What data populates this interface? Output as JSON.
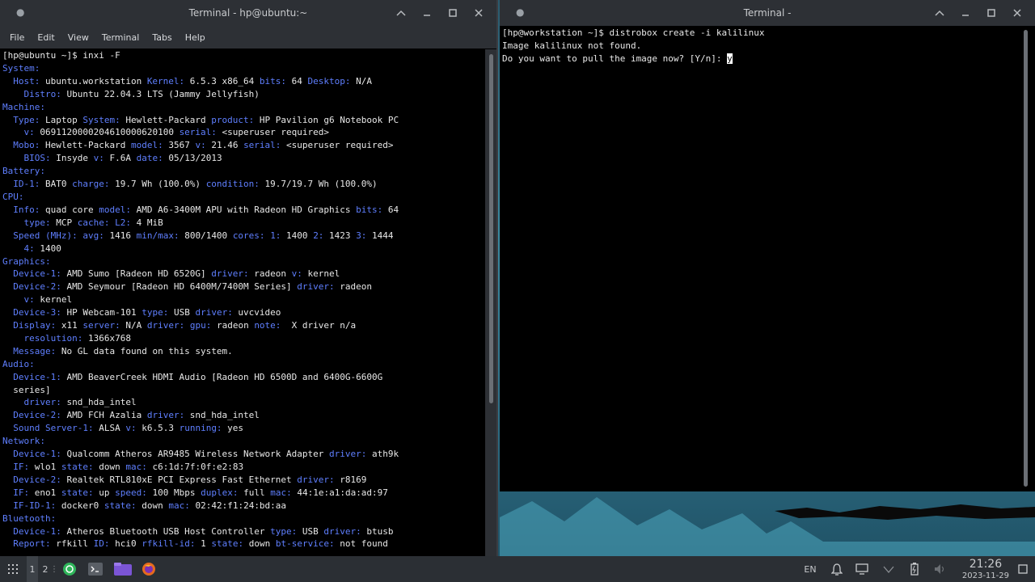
{
  "left_window": {
    "title": "Terminal - hp@ubuntu:~",
    "menu": [
      "File",
      "Edit",
      "View",
      "Terminal",
      "Tabs",
      "Help"
    ],
    "lines": [
      [
        [
          "n",
          "[hp@ubuntu ~]$ inxi -F"
        ]
      ],
      [
        [
          "k",
          "System:"
        ]
      ],
      [
        [
          "k",
          "  Host:"
        ],
        [
          "n",
          " ubuntu.workstation "
        ],
        [
          "k",
          "Kernel:"
        ],
        [
          "n",
          " 6.5.3 x86_64 "
        ],
        [
          "k",
          "bits:"
        ],
        [
          "n",
          " 64 "
        ],
        [
          "k",
          "Desktop:"
        ],
        [
          "n",
          " N/A"
        ]
      ],
      [
        [
          "k",
          "    Distro:"
        ],
        [
          "n",
          " Ubuntu 22.04.3 LTS (Jammy Jellyfish)"
        ]
      ],
      [
        [
          "k",
          "Machine:"
        ]
      ],
      [
        [
          "k",
          "  Type:"
        ],
        [
          "n",
          " Laptop "
        ],
        [
          "k",
          "System:"
        ],
        [
          "n",
          " Hewlett-Packard "
        ],
        [
          "k",
          "product:"
        ],
        [
          "n",
          " HP Pavilion g6 Notebook PC"
        ]
      ],
      [
        [
          "k",
          "    v:"
        ],
        [
          "n",
          " 0691120000204610000620100 "
        ],
        [
          "k",
          "serial:"
        ],
        [
          "n",
          " <superuser required>"
        ]
      ],
      [
        [
          "k",
          "  Mobo:"
        ],
        [
          "n",
          " Hewlett-Packard "
        ],
        [
          "k",
          "model:"
        ],
        [
          "n",
          " 3567 "
        ],
        [
          "k",
          "v:"
        ],
        [
          "n",
          " 21.46 "
        ],
        [
          "k",
          "serial:"
        ],
        [
          "n",
          " <superuser required>"
        ]
      ],
      [
        [
          "k",
          "    BIOS:"
        ],
        [
          "n",
          " Insyde "
        ],
        [
          "k",
          "v:"
        ],
        [
          "n",
          " F.6A "
        ],
        [
          "k",
          "date:"
        ],
        [
          "n",
          " 05/13/2013"
        ]
      ],
      [
        [
          "k",
          "Battery:"
        ]
      ],
      [
        [
          "k",
          "  ID-1:"
        ],
        [
          "n",
          " BAT0 "
        ],
        [
          "k",
          "charge:"
        ],
        [
          "n",
          " 19.7 Wh (100.0%) "
        ],
        [
          "k",
          "condition:"
        ],
        [
          "n",
          " 19.7/19.7 Wh (100.0%)"
        ]
      ],
      [
        [
          "k",
          "CPU:"
        ]
      ],
      [
        [
          "k",
          "  Info:"
        ],
        [
          "n",
          " quad core "
        ],
        [
          "k",
          "model:"
        ],
        [
          "n",
          " AMD A6-3400M APU with Radeon HD Graphics "
        ],
        [
          "k",
          "bits:"
        ],
        [
          "n",
          " 64"
        ]
      ],
      [
        [
          "k",
          "    type:"
        ],
        [
          "n",
          " MCP "
        ],
        [
          "k",
          "cache:"
        ],
        [
          "n",
          " "
        ],
        [
          "k",
          "L2:"
        ],
        [
          "n",
          " 4 MiB"
        ]
      ],
      [
        [
          "k",
          "  Speed (MHz):"
        ],
        [
          "n",
          " "
        ],
        [
          "k",
          "avg:"
        ],
        [
          "n",
          " 1416 "
        ],
        [
          "k",
          "min/max:"
        ],
        [
          "n",
          " 800/1400 "
        ],
        [
          "k",
          "cores:"
        ],
        [
          "n",
          " "
        ],
        [
          "k",
          "1:"
        ],
        [
          "n",
          " 1400 "
        ],
        [
          "k",
          "2:"
        ],
        [
          "n",
          " 1423 "
        ],
        [
          "k",
          "3:"
        ],
        [
          "n",
          " 1444"
        ]
      ],
      [
        [
          "k",
          "    4:"
        ],
        [
          "n",
          " 1400"
        ]
      ],
      [
        [
          "k",
          "Graphics:"
        ]
      ],
      [
        [
          "k",
          "  Device-1:"
        ],
        [
          "n",
          " AMD Sumo [Radeon HD 6520G] "
        ],
        [
          "k",
          "driver:"
        ],
        [
          "n",
          " radeon "
        ],
        [
          "k",
          "v:"
        ],
        [
          "n",
          " kernel"
        ]
      ],
      [
        [
          "k",
          "  Device-2:"
        ],
        [
          "n",
          " AMD Seymour [Radeon HD 6400M/7400M Series] "
        ],
        [
          "k",
          "driver:"
        ],
        [
          "n",
          " radeon"
        ]
      ],
      [
        [
          "k",
          "    v:"
        ],
        [
          "n",
          " kernel"
        ]
      ],
      [
        [
          "k",
          "  Device-3:"
        ],
        [
          "n",
          " HP Webcam-101 "
        ],
        [
          "k",
          "type:"
        ],
        [
          "n",
          " USB "
        ],
        [
          "k",
          "driver:"
        ],
        [
          "n",
          " uvcvideo"
        ]
      ],
      [
        [
          "k",
          "  Display:"
        ],
        [
          "n",
          " x11 "
        ],
        [
          "k",
          "server:"
        ],
        [
          "n",
          " N/A "
        ],
        [
          "k",
          "driver:"
        ],
        [
          "n",
          " "
        ],
        [
          "k",
          "gpu:"
        ],
        [
          "n",
          " radeon "
        ],
        [
          "k",
          "note:"
        ],
        [
          "n",
          "  X driver n/a"
        ]
      ],
      [
        [
          "k",
          "    resolution:"
        ],
        [
          "n",
          " 1366x768"
        ]
      ],
      [
        [
          "k",
          "  Message:"
        ],
        [
          "n",
          " No GL data found on this system."
        ]
      ],
      [
        [
          "k",
          "Audio:"
        ]
      ],
      [
        [
          "k",
          "  Device-1:"
        ],
        [
          "n",
          " AMD BeaverCreek HDMI Audio [Radeon HD 6500D and 6400G-6600G"
        ]
      ],
      [
        [
          "n",
          "  series]"
        ]
      ],
      [
        [
          "k",
          "    driver:"
        ],
        [
          "n",
          " snd_hda_intel"
        ]
      ],
      [
        [
          "k",
          "  Device-2:"
        ],
        [
          "n",
          " AMD FCH Azalia "
        ],
        [
          "k",
          "driver:"
        ],
        [
          "n",
          " snd_hda_intel"
        ]
      ],
      [
        [
          "k",
          "  Sound Server-1:"
        ],
        [
          "n",
          " ALSA "
        ],
        [
          "k",
          "v:"
        ],
        [
          "n",
          " k6.5.3 "
        ],
        [
          "k",
          "running:"
        ],
        [
          "n",
          " yes"
        ]
      ],
      [
        [
          "k",
          "Network:"
        ]
      ],
      [
        [
          "k",
          "  Device-1:"
        ],
        [
          "n",
          " Qualcomm Atheros AR9485 Wireless Network Adapter "
        ],
        [
          "k",
          "driver:"
        ],
        [
          "n",
          " ath9k"
        ]
      ],
      [
        [
          "k",
          "  IF:"
        ],
        [
          "n",
          " wlo1 "
        ],
        [
          "k",
          "state:"
        ],
        [
          "n",
          " down "
        ],
        [
          "k",
          "mac:"
        ],
        [
          "n",
          " c6:1d:7f:0f:e2:83"
        ]
      ],
      [
        [
          "k",
          "  Device-2:"
        ],
        [
          "n",
          " Realtek RTL810xE PCI Express Fast Ethernet "
        ],
        [
          "k",
          "driver:"
        ],
        [
          "n",
          " r8169"
        ]
      ],
      [
        [
          "k",
          "  IF:"
        ],
        [
          "n",
          " eno1 "
        ],
        [
          "k",
          "state:"
        ],
        [
          "n",
          " up "
        ],
        [
          "k",
          "speed:"
        ],
        [
          "n",
          " 100 Mbps "
        ],
        [
          "k",
          "duplex:"
        ],
        [
          "n",
          " full "
        ],
        [
          "k",
          "mac:"
        ],
        [
          "n",
          " 44:1e:a1:da:ad:97"
        ]
      ],
      [
        [
          "k",
          "  IF-ID-1:"
        ],
        [
          "n",
          " docker0 "
        ],
        [
          "k",
          "state:"
        ],
        [
          "n",
          " down "
        ],
        [
          "k",
          "mac:"
        ],
        [
          "n",
          " 02:42:f1:24:bd:aa"
        ]
      ],
      [
        [
          "k",
          "Bluetooth:"
        ]
      ],
      [
        [
          "k",
          "  Device-1:"
        ],
        [
          "n",
          " Atheros Bluetooth USB Host Controller "
        ],
        [
          "k",
          "type:"
        ],
        [
          "n",
          " USB "
        ],
        [
          "k",
          "driver:"
        ],
        [
          "n",
          " btusb"
        ]
      ],
      [
        [
          "k",
          "  Report:"
        ],
        [
          "n",
          " rfkill "
        ],
        [
          "k",
          "ID:"
        ],
        [
          "n",
          " hci0 "
        ],
        [
          "k",
          "rfkill-id:"
        ],
        [
          "n",
          " 1 "
        ],
        [
          "k",
          "state:"
        ],
        [
          "n",
          " down "
        ],
        [
          "k",
          "bt-service:"
        ],
        [
          "n",
          " not found"
        ]
      ]
    ]
  },
  "right_window": {
    "title": "Terminal -",
    "lines": [
      "[hp@workstation ~]$ distrobox create -i kalilinux",
      "Image kalilinux not found.",
      "Do you want to pull the image now? [Y/n]: "
    ],
    "typed": "y"
  },
  "taskbar": {
    "workspaces": [
      "1",
      "2"
    ],
    "language": "EN",
    "time": "21:26",
    "date": "2023-11-29"
  },
  "colors": {
    "keyword": "#5f7fff",
    "text": "#e8e8e8",
    "titlebar": "#2d3035",
    "taskbar": "#2b2f34"
  }
}
